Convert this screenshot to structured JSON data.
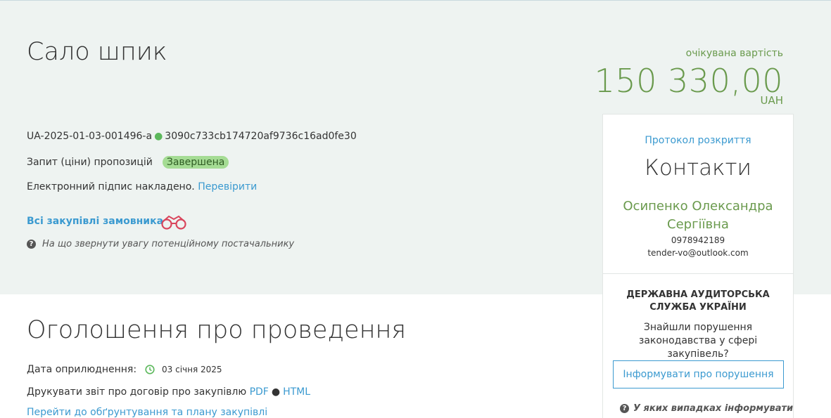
{
  "header": {
    "title": "Сало шпик",
    "tender_id": "UA-2025-01-03-001496-a",
    "tender_hash": "3090c733cb174720af9736c16ad0fe30",
    "method": "Запит (ціни) пропозицій",
    "status": "Завершена",
    "signature_text": "Електронний підпис накладено.",
    "signature_link": "Перевірити",
    "all_purchases_link": "Всі закупівлі замовника",
    "hint": "На що звернути увагу потенційному постачальнику"
  },
  "price": {
    "label": "очікувана вартість",
    "amount": "150 330,00",
    "currency": "UAH"
  },
  "sidebar": {
    "protocol_link": "Протокол розкриття",
    "contacts_title": "Контакти",
    "contact_name": "Осипенко Олександра Сергіївна",
    "phone": "0978942189",
    "email": "tender-vo@outlook.com",
    "audit_title": "ДЕРЖАВНА АУДИТОРСЬКА СЛУЖБА УКРАЇНИ",
    "audit_text": "Знайшли порушення законодавства у сфері закупівель?",
    "report_button": "Інформувати про порушення",
    "audit_hint": "У яких випадках інформувати"
  },
  "announcement": {
    "title": "Оголошення про проведення",
    "date_label": "Дата оприлюднення:",
    "date_value": "03 січня 2025",
    "print_text": "Друкувати звіт про договір про закупівлю",
    "pdf_link": "PDF",
    "html_link": "HTML",
    "plan_link": "Перейти до обґрунтування та плану закупівлі"
  },
  "colors": {
    "accent_green": "#6a9a4d",
    "link_blue": "#3b9ad0",
    "status_badge": "#a5dc94",
    "hero_bg": "#eef3f1"
  }
}
